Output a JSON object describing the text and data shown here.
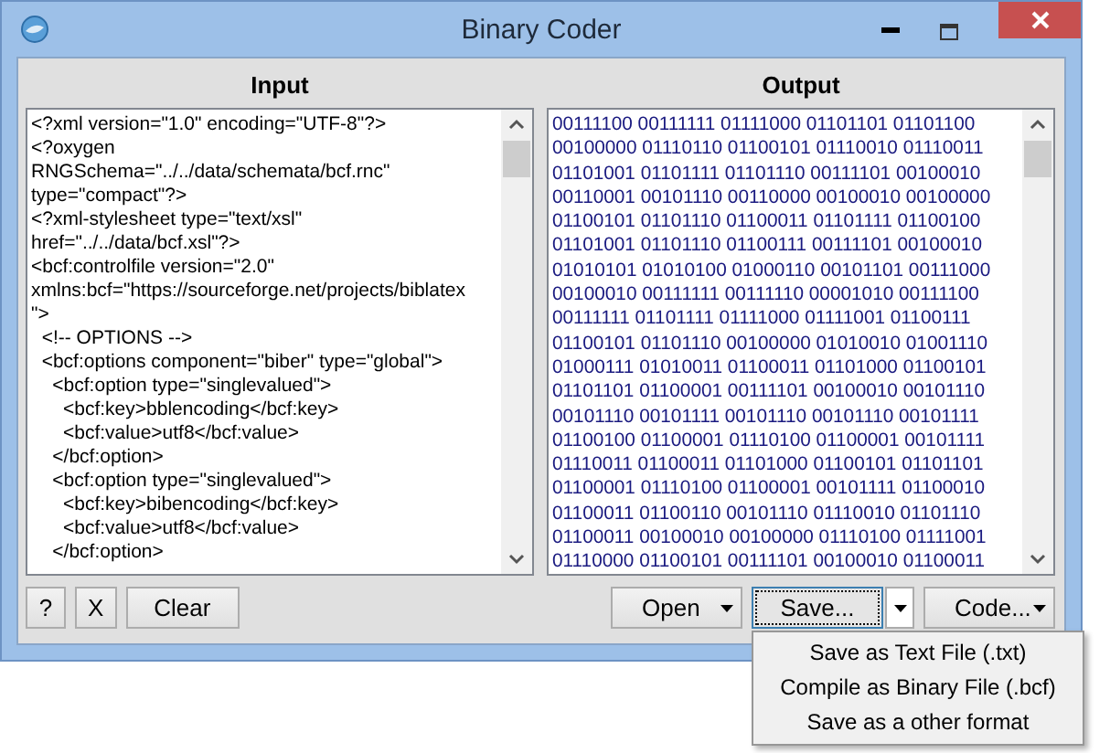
{
  "window": {
    "title": "Binary Coder"
  },
  "input": {
    "heading": "Input",
    "lines": [
      "<?xml version=\"1.0\" encoding=\"UTF-8\"?>",
      "<?oxygen",
      "RNGSchema=\"../../data/schemata/bcf.rnc\"",
      "type=\"compact\"?>",
      "<?xml-stylesheet type=\"text/xsl\"",
      "href=\"../../data/bcf.xsl\"?>",
      "<bcf:controlfile version=\"2.0\"",
      "xmlns:bcf=\"https://sourceforge.net/projects/biblatex",
      "\">",
      "  <!-- OPTIONS -->",
      "  <bcf:options component=\"biber\" type=\"global\">",
      "    <bcf:option type=\"singlevalued\">",
      "      <bcf:key>bblencoding</bcf:key>",
      "      <bcf:value>utf8</bcf:value>",
      "    </bcf:option>",
      "    <bcf:option type=\"singlevalued\">",
      "      <bcf:key>bibencoding</bcf:key>",
      "      <bcf:value>utf8</bcf:value>",
      "    </bcf:option>"
    ]
  },
  "output": {
    "heading": "Output",
    "lines": [
      "00111100 00111111 01111000 01101101 01101100",
      "00100000 01110110 01100101 01110010 01110011",
      "01101001 01101111 01101110 00111101 00100010",
      "00110001 00101110 00110000 00100010 00100000",
      "01100101 01101110 01100011 01101111 01100100",
      "01101001 01101110 01100111 00111101 00100010",
      "01010101 01010100 01000110 00101101 00111000",
      "00100010 00111111 00111110 00001010 00111100",
      "00111111 01101111 01111000 01111001 01100111",
      "01100101 01101110 00100000 01010010 01001110",
      "01000111 01010011 01100011 01101000 01100101",
      "01101101 01100001 00111101 00100010 00101110",
      "00101110 00101111 00101110 00101110 00101111",
      "01100100 01100001 01110100 01100001 00101111",
      "01110011 01100011 01101000 01100101 01101101",
      "01100001 01110100 01100001 00101111 01100010",
      "01100011 01100110 00101110 01110010 01101110",
      "01100011 00100010 00100000 01110100 01111001",
      "01110000 01100101 00111101 00100010 01100011"
    ]
  },
  "left_buttons": [
    "?",
    "X",
    "Clear"
  ],
  "right_buttons": [
    {
      "label": "Open",
      "kind": "dropdown",
      "expanded": false
    },
    {
      "label": "Save...",
      "kind": "split",
      "expanded": true
    },
    {
      "label": "Code...",
      "kind": "dropdown",
      "expanded": false
    }
  ],
  "save_menu": {
    "items": [
      "Save as Text File (.txt)",
      "Compile as Binary File (.bcf)",
      "Save as a other format"
    ]
  }
}
